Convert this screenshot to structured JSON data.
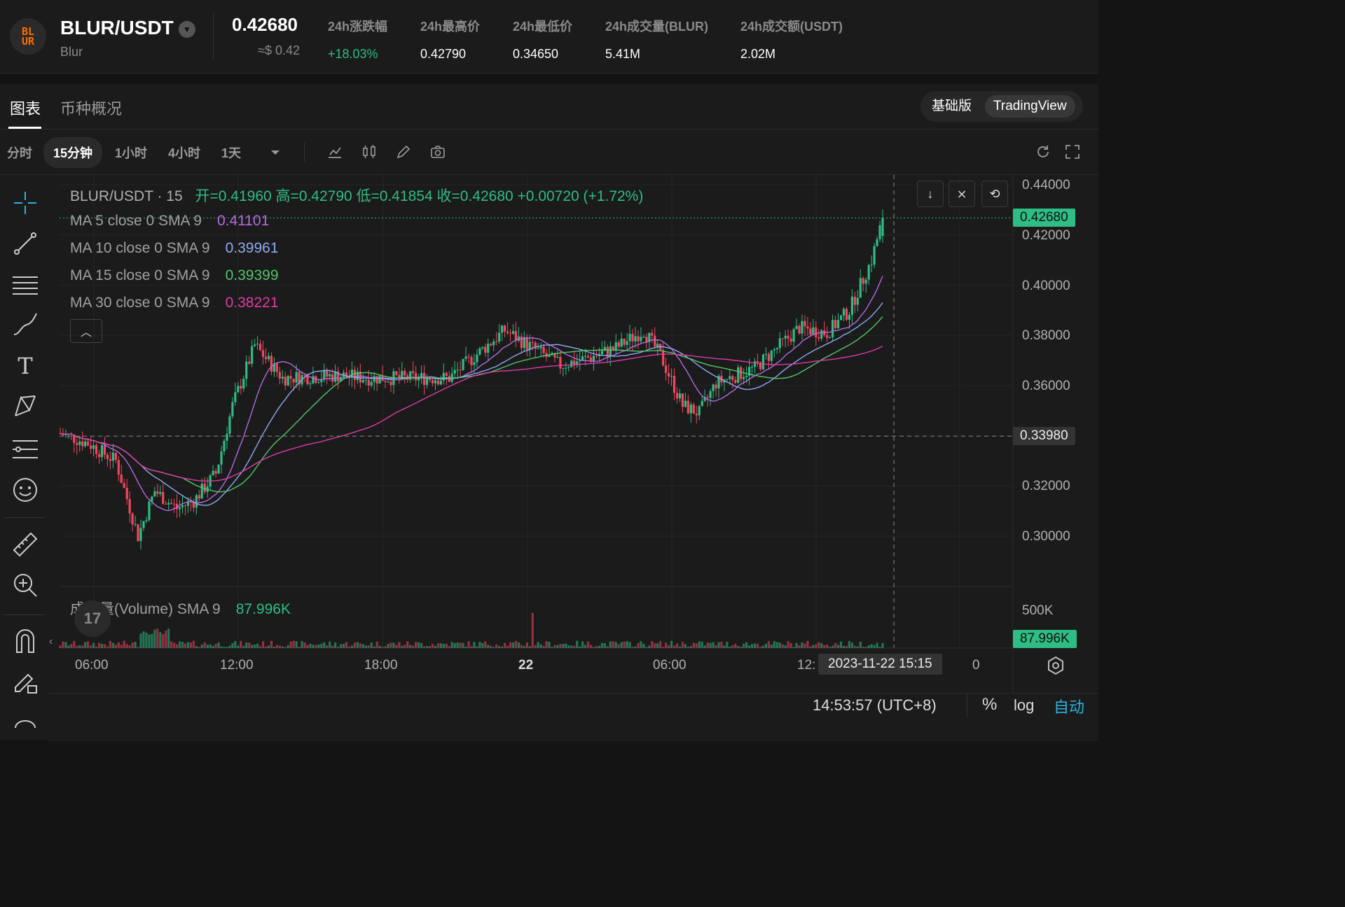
{
  "header": {
    "logo_text": "BLUR",
    "pair": "BLUR/USDT",
    "name": "Blur",
    "price": "0.42680",
    "price_usd": "≈$ 0.42",
    "stats": [
      {
        "label": "24h涨跌幅",
        "value": "+18.03%",
        "color": "#2ebd85"
      },
      {
        "label": "24h最高价",
        "value": "0.42790",
        "color": "#ffffff"
      },
      {
        "label": "24h最低价",
        "value": "0.34650",
        "color": "#ffffff"
      },
      {
        "label": "24h成交量(BLUR)",
        "value": "5.41M",
        "color": "#ffffff"
      },
      {
        "label": "24h成交额(USDT)",
        "value": "2.02M",
        "color": "#ffffff"
      }
    ]
  },
  "tabs": {
    "chart": "图表",
    "overview": "币种概况",
    "basic": "基础版",
    "tradingview": "TradingView"
  },
  "toolbar": {
    "timeframes": [
      "分时",
      "15分钟",
      "1小时",
      "4小时",
      "1天"
    ],
    "selected": "15分钟"
  },
  "chart": {
    "title": "BLUR/USDT · 15",
    "ohlc": "开=0.41960 高=0.42790 低=0.41854 收=0.42680 +0.00720 (+1.72%)",
    "ma": [
      {
        "label": "MA 5 close 0 SMA 9",
        "value": "0.41101",
        "color": "#b46ae0"
      },
      {
        "label": "MA 10 close 0 SMA 9",
        "value": "0.39961",
        "color": "#8fa8f0"
      },
      {
        "label": "MA 15 close 0 SMA 9",
        "value": "0.39399",
        "color": "#52c56a"
      },
      {
        "label": "MA 30 close 0 SMA 9",
        "value": "0.38221",
        "color": "#e03aa6"
      }
    ],
    "price_axis": [
      "0.44000",
      "0.42000",
      "0.40000",
      "0.38000",
      "0.36000",
      "0.32000",
      "0.30000"
    ],
    "last_price_tag": "0.42680",
    "crosshair_price_tag": "0.33980",
    "volume_label": "成交量(Volume) SMA 9",
    "volume_value": "87.996K",
    "volume_axis": "500K",
    "volume_tag": "87.996K",
    "time_axis": [
      "06:00",
      "12:00",
      "18:00",
      "22",
      "06:00",
      "12:"
    ],
    "time_axis_tail": "0",
    "crosshair_time": "2023-11-22   15:15",
    "clock": "14:53:57 (UTC+8)",
    "percent": "%",
    "log": "log",
    "auto": "自动",
    "watermark": "17",
    "collapse_arrow": "‹"
  },
  "colors": {
    "up": "#2ebd85",
    "down": "#f6465d",
    "accent": "#2ebd85"
  },
  "chart_data": {
    "type": "candlestick",
    "title": "BLUR/USDT · 15",
    "ylim": [
      0.295,
      0.445
    ],
    "candles": [],
    "last_close": 0.4268
  }
}
